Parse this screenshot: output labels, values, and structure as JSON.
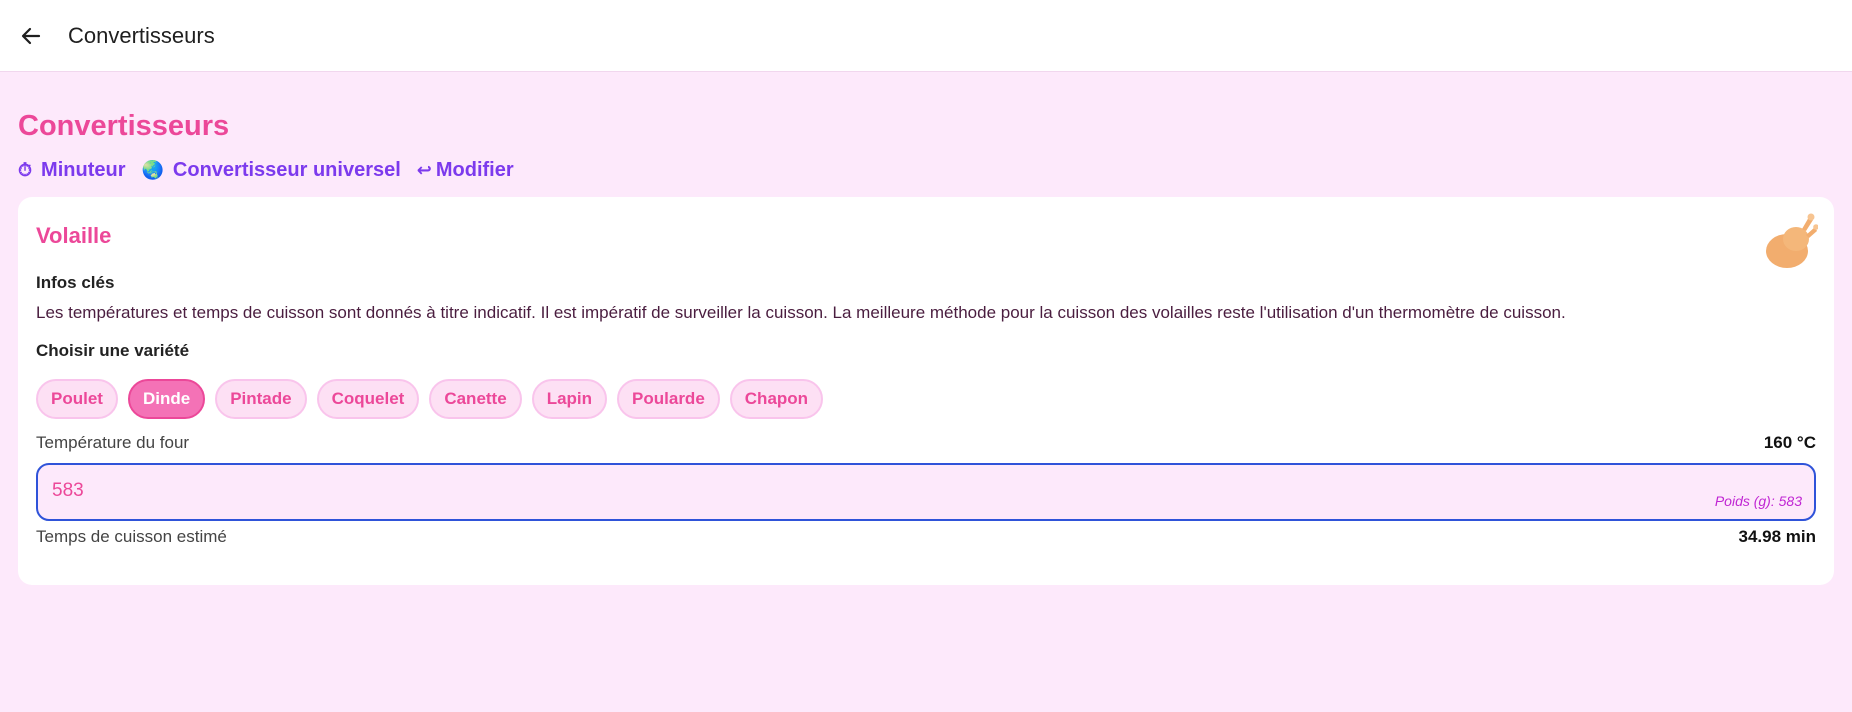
{
  "appbar": {
    "title": "Convertisseurs"
  },
  "page": {
    "title": "Convertisseurs",
    "links": [
      {
        "icon": "stopwatch-icon",
        "glyph": "⏱",
        "label": "Minuteur"
      },
      {
        "icon": "globe-icon",
        "glyph": "🌏",
        "label": "Convertisseur universel"
      },
      {
        "icon": "return-arrow-icon",
        "glyph": "↩",
        "label": "Modifier"
      }
    ]
  },
  "card": {
    "title": "Volaille",
    "key_info_label": "Infos clés",
    "key_info_text": "Les températures et temps de cuisson sont donnés à titre indicatif. Il est impératif de surveiller la cuisson. La meilleure méthode pour la cuisson des volailles reste l'utilisation d'un thermomètre de cuisson.",
    "choose_label": "Choisir une variété",
    "varieties": [
      "Poulet",
      "Dinde",
      "Pintade",
      "Coquelet",
      "Canette",
      "Lapin",
      "Poularde",
      "Chapon"
    ],
    "selected_variety": "Dinde",
    "oven": {
      "label": "Température du four",
      "value": "160 °C"
    },
    "weight": {
      "value": "583",
      "hint": "Poids (g): 583"
    },
    "time": {
      "label": "Temps de cuisson estimé",
      "value": "34.98 min"
    }
  },
  "colors": {
    "accent_pink": "#ec4899",
    "accent_purple": "#7c3aed",
    "background": "#fde9fb",
    "focus_border": "#2f53d9"
  }
}
